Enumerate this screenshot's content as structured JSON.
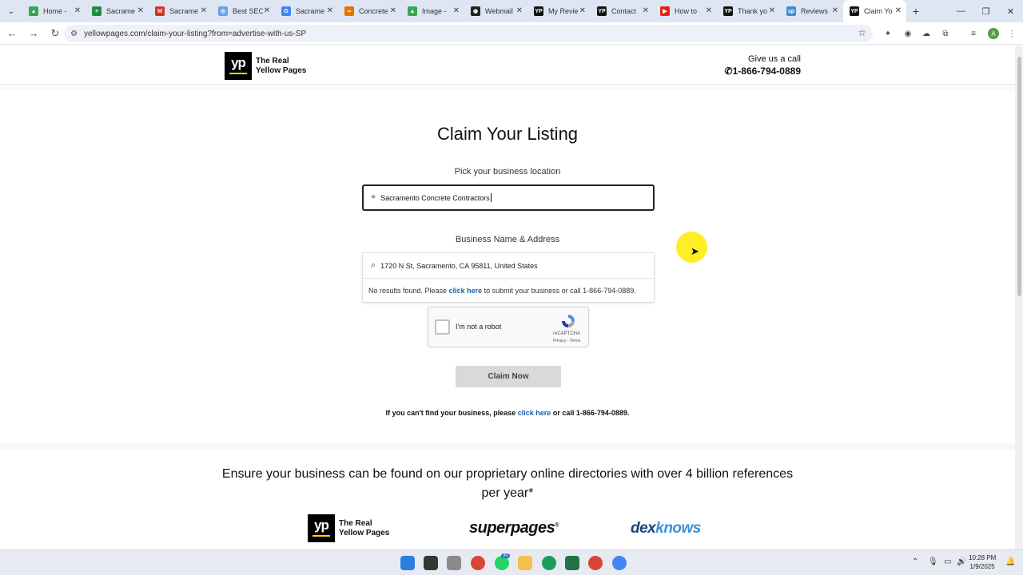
{
  "browser": {
    "tabs": [
      {
        "label": "Home - ",
        "color": "#34a853",
        "glyph": "▲"
      },
      {
        "label": "Sacrame",
        "color": "#1e8e3e",
        "glyph": "+"
      },
      {
        "label": "Sacrame",
        "color": "#d93025",
        "glyph": "M"
      },
      {
        "label": "Best SEO",
        "color": "#6aa2e6",
        "glyph": "◎"
      },
      {
        "label": "Sacrame",
        "color": "#4285f4",
        "glyph": "G"
      },
      {
        "label": "Concrete",
        "color": "#e37400",
        "glyph": "∞"
      },
      {
        "label": "Image - ",
        "color": "#34a853",
        "glyph": "▲"
      },
      {
        "label": "Webmail",
        "color": "#222222",
        "glyph": "◉"
      },
      {
        "label": "My Revie",
        "color": "#111111",
        "glyph": "YP"
      },
      {
        "label": "Contact ",
        "color": "#111111",
        "glyph": "YP"
      },
      {
        "label": "How to ",
        "color": "#e62117",
        "glyph": "▶"
      },
      {
        "label": "Thank yo",
        "color": "#111111",
        "glyph": "YP"
      },
      {
        "label": "Reviews",
        "color": "#3a8fd6",
        "glyph": "sp"
      },
      {
        "label": "Claim Yo",
        "color": "#111111",
        "glyph": "YP"
      }
    ],
    "url": "yellowpages.com/claim-your-listing?from=advertise-with-us-SP",
    "profile_initial": "A"
  },
  "header": {
    "logo_line1": "The Real",
    "logo_line2": "Yellow Pages",
    "logo_mark": "yp",
    "call_label": "Give us a call",
    "call_phone": "1-866-794-0889"
  },
  "form": {
    "title": "Claim Your Listing",
    "location_label": "Pick your business location",
    "location_value": "Sacramento Concrete Contractors",
    "business_label": "Business Name & Address",
    "business_value": "1720 N St, Sacramento, CA 95811, United States",
    "no_results_prefix": "No results found. Please",
    "no_results_link": "click here",
    "no_results_suffix": "to submit your business or call 1-866-794-0889.",
    "captcha_label": "I'm not a robot",
    "captcha_brand": "reCAPTCHA",
    "captcha_links": "Privacy - Terms",
    "submit_label": "Claim Now",
    "cant_find_prefix": "If you can't find your business, please",
    "cant_find_link": "click here",
    "cant_find_suffix": "or call 1-866-794-0889."
  },
  "promo": {
    "text": "Ensure your business can be found on our proprietary online directories with over 4 billion references per year*",
    "logos": {
      "yp_line1": "The Real",
      "yp_line2": "Yellow Pages",
      "superpages": "superpages",
      "dex_a": "dex",
      "dex_b": "knows"
    }
  },
  "taskbar": {
    "time": "10:28 PM",
    "date": "1/9/2025",
    "whatsapp_badge": "30"
  },
  "icons": [
    "tab-menu-icon",
    "close-icon",
    "new-tab-icon",
    "back-icon",
    "forward-icon",
    "reload-icon",
    "site-info-icon",
    "star-icon",
    "location-pin-icon",
    "search-icon",
    "recaptcha-icon",
    "phone-icon"
  ]
}
